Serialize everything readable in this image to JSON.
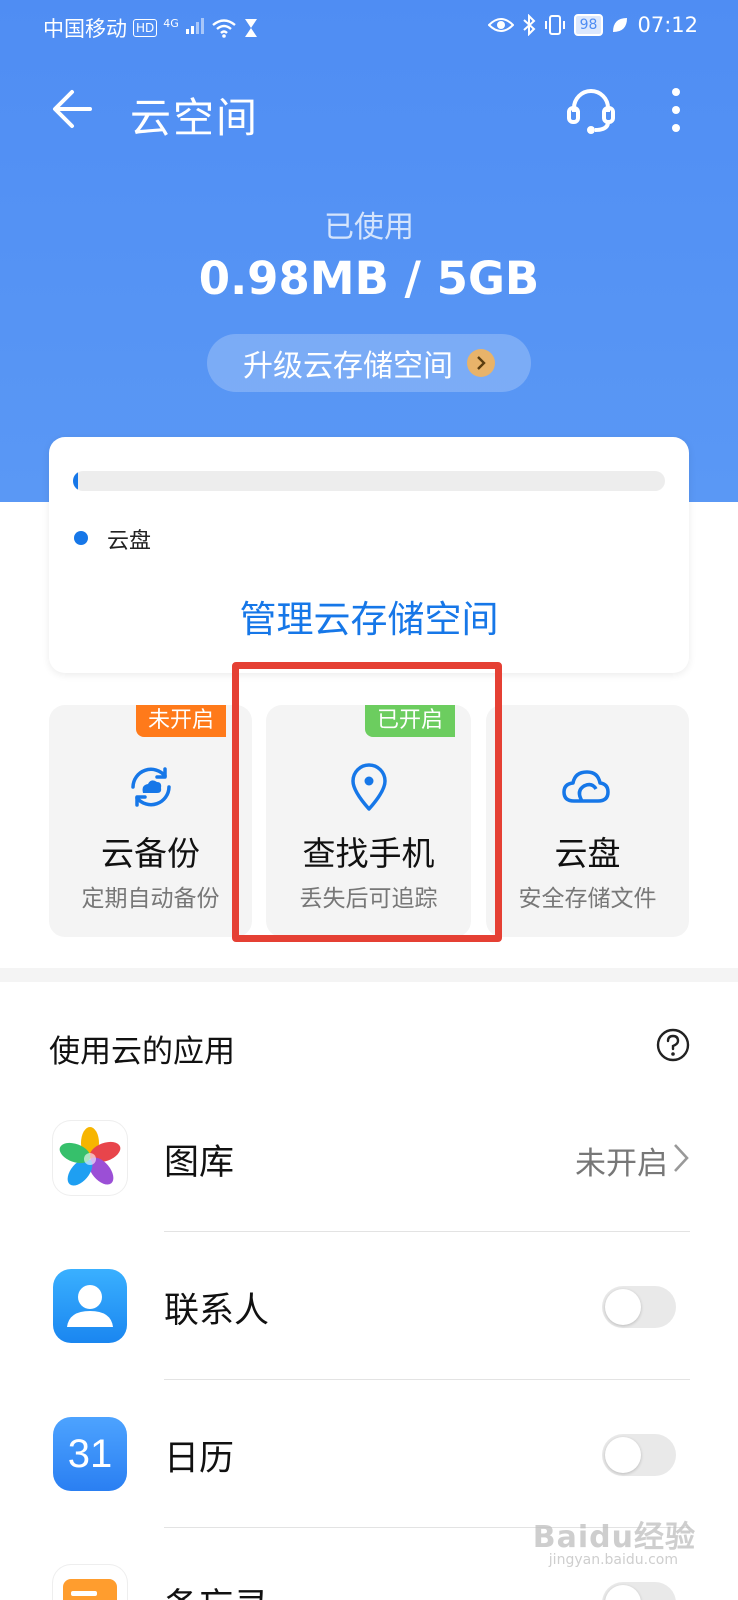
{
  "status_bar": {
    "carrier": "中国移动",
    "hd": "HD",
    "signal_type": "4G",
    "battery": "98",
    "time": "07:12"
  },
  "header": {
    "title": "云空间"
  },
  "storage": {
    "used_label": "已使用",
    "used_value": "0.98MB / 5GB",
    "usage_fraction": 0.0002,
    "upgrade_label": "升级云存储空间",
    "legend_label": "云盘",
    "manage_label": "管理云存储空间"
  },
  "tiles": [
    {
      "title": "云备份",
      "subtitle": "定期自动备份",
      "badge": "未开启",
      "badge_color": "#ff7a1a",
      "icon": "cloud-sync-icon"
    },
    {
      "title": "查找手机",
      "subtitle": "丢失后可追踪",
      "badge": "已开启",
      "badge_color": "#6ccd5f",
      "icon": "location-pin-icon"
    },
    {
      "title": "云盘",
      "subtitle": "安全存储文件",
      "badge": "",
      "badge_color": "",
      "icon": "cloud-icon"
    }
  ],
  "apps_section": {
    "title": "使用云的应用",
    "apps": [
      {
        "name": "图库",
        "status": "未开启",
        "control": "chevron",
        "icon": "gallery-flower-icon"
      },
      {
        "name": "联系人",
        "status": "",
        "control": "toggle",
        "icon": "contact-person-icon",
        "enabled": false
      },
      {
        "name": "日历",
        "status": "",
        "control": "toggle",
        "icon": "calendar-icon",
        "calendar_day": "31",
        "enabled": false
      },
      {
        "name": "备忘录",
        "status": "",
        "control": "toggle",
        "icon": "notes-icon",
        "enabled": false
      }
    ]
  },
  "watermark": {
    "text": "Baidu经验",
    "sub": "jingyan.baidu.com"
  },
  "colors": {
    "accent": "#1677e8",
    "header_blue": "#4f8df3",
    "highlight_red": "#e54034"
  }
}
